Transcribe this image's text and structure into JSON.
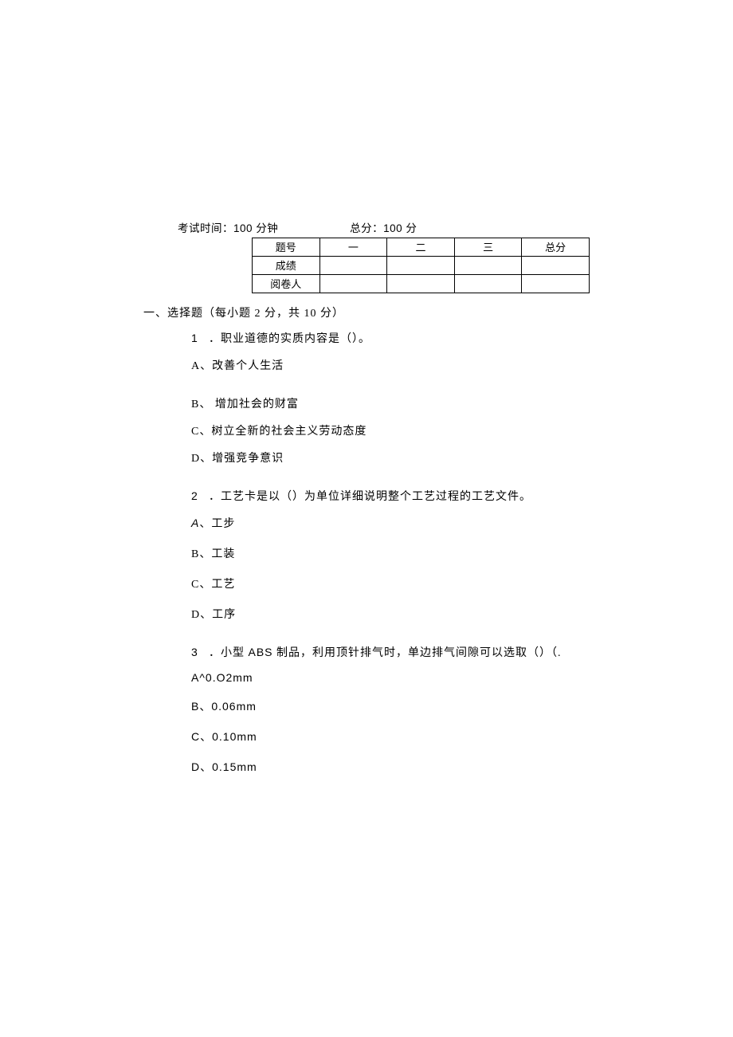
{
  "exam": {
    "time_label": "考试时间：",
    "time_value": "100 分钟",
    "score_label": "总分：",
    "score_value": "100 分"
  },
  "table": {
    "row1": {
      "label": "题号",
      "c1": "一",
      "c2": "二",
      "c3": "三",
      "total": "总分"
    },
    "row2": {
      "label": "成绩",
      "c1": "",
      "c2": "",
      "c3": "",
      "total": ""
    },
    "row3": {
      "label": "阅卷人",
      "c1": "",
      "c2": "",
      "c3": "",
      "total": ""
    }
  },
  "section1": {
    "title": "一、选择题（每小题 2 分，共 10 分）"
  },
  "q1": {
    "num": "1",
    "text": "．职业道德的实质内容是（）。",
    "a": "A、改善个人生活",
    "b": "B、 增加社会的财富",
    "c": "C、树立全新的社会主义劳动态度",
    "d": "D、增强竞争意识"
  },
  "q2": {
    "num": "2",
    "text": "．工艺卡是以（）为单位详细说明整个工艺过程的工艺文件。",
    "a_letter": "A",
    "a_text": "、工步",
    "b": "B、工装",
    "c": "C、工艺",
    "d": "D、工序"
  },
  "q3": {
    "num": "3",
    "text_part1": "．小型 ",
    "text_abs": "ABS",
    "text_part2": " 制品，利用顶针排气时，单边排气间隙可以选取（）（.",
    "a": "A^0.O2mm",
    "b": "B、0.06mm",
    "c": "C、0.10mm",
    "d": "D、0.15mm"
  }
}
